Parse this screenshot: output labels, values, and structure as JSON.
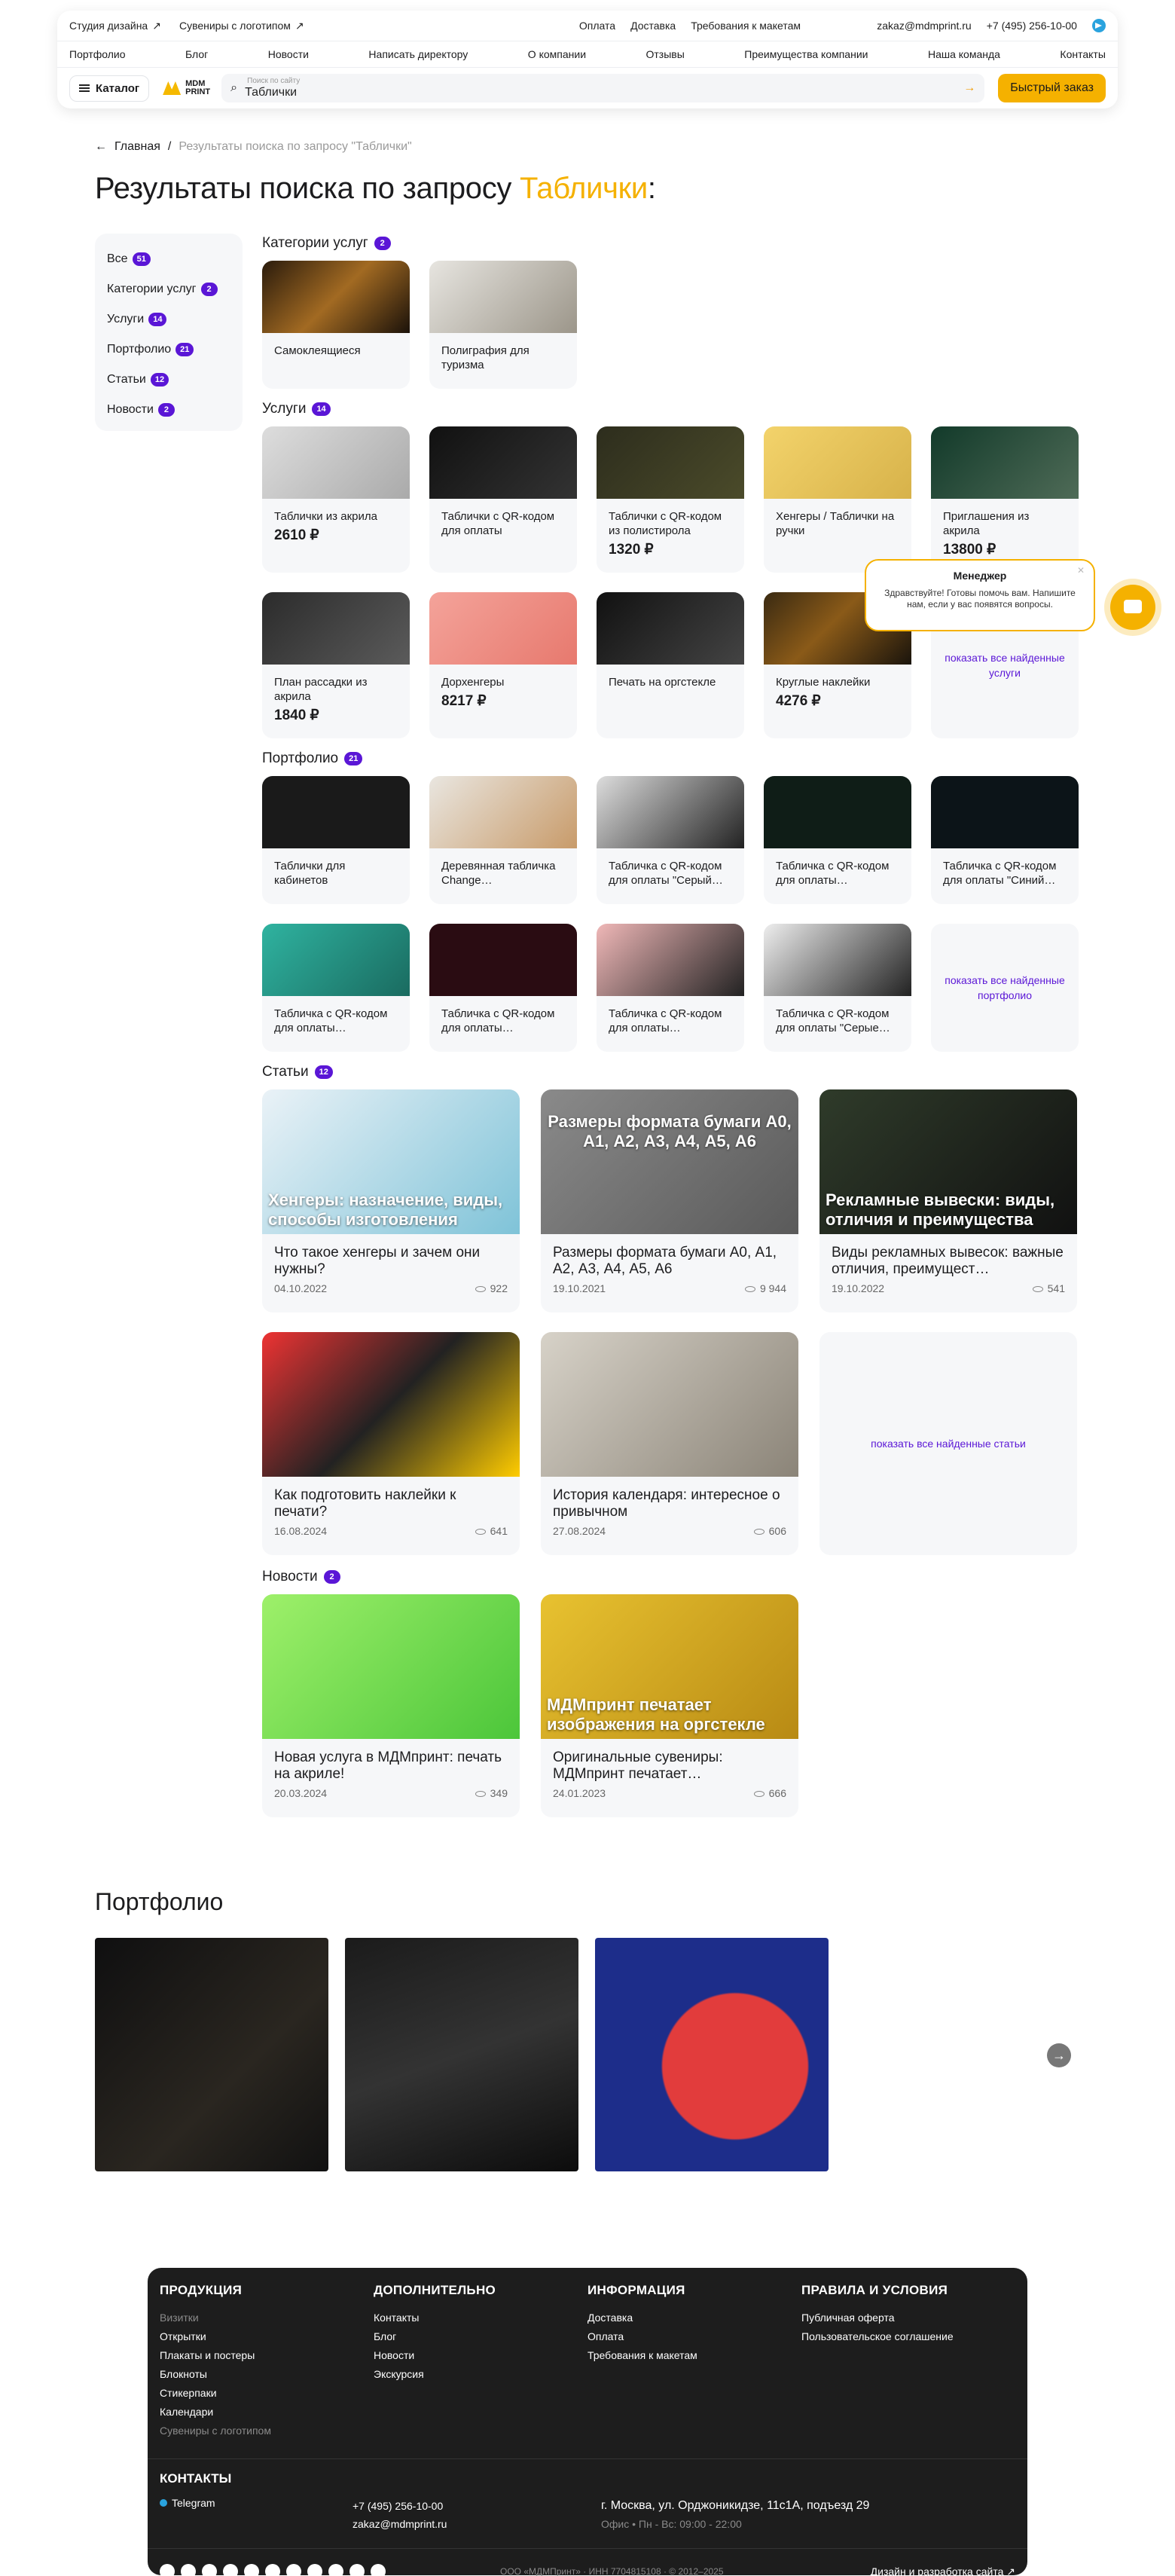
{
  "header": {
    "top_links": [
      "Студия дизайна",
      "Сувениры с логотипом"
    ],
    "top_mid": [
      "Оплата",
      "Доставка",
      "Требования к макетам"
    ],
    "email": "zakaz@mdmprint.ru",
    "phone": "+7 (495) 256-10-00",
    "nav": [
      "Портфолио",
      "Блог",
      "Новости",
      "Написать директору",
      "О компании",
      "Отзывы",
      "Преимущества компании",
      "Наша команда",
      "Контакты"
    ],
    "catalog_label": "Каталог",
    "logo_text": "MDM PRINT",
    "search_hint": "Поиск по сайту",
    "search_value": "Таблички",
    "quick_order": "Быстрый заказ"
  },
  "breadcrumb": {
    "home": "Главная",
    "current": "Результаты поиска по запросу \"Таблички\""
  },
  "page_title": {
    "prefix": "Результаты поиска по запросу",
    "query": "Таблички",
    "suffix": ":"
  },
  "sidebar": [
    {
      "label": "Все",
      "count": "51"
    },
    {
      "label": "Категории услуг",
      "count": "2"
    },
    {
      "label": "Услуги",
      "count": "14"
    },
    {
      "label": "Портфолио",
      "count": "21"
    },
    {
      "label": "Статьи",
      "count": "12"
    },
    {
      "label": "Новости",
      "count": "2"
    }
  ],
  "sections": {
    "categories": {
      "title": "Категории услуг",
      "count": "2",
      "items": [
        "Самоклеящиеся",
        "Полиграфия для туризма"
      ]
    },
    "services": {
      "title": "Услуги",
      "count": "14",
      "items": [
        {
          "t": "Таблички из акрила",
          "p": "2610 ₽"
        },
        {
          "t": "Таблички с QR-кодом для оплаты",
          "p": ""
        },
        {
          "t": "Таблички с QR-кодом из полистирола",
          "p": "1320 ₽"
        },
        {
          "t": "Хенгеры / Таблички на ручки",
          "p": ""
        },
        {
          "t": "Приглашения из акрила",
          "p": "13800 ₽"
        },
        {
          "t": "План рассадки из акрила",
          "p": "1840 ₽"
        },
        {
          "t": "Дорхенгеры",
          "p": "8217 ₽"
        },
        {
          "t": "Печать на оргстекле",
          "p": ""
        },
        {
          "t": "Круглые наклейки",
          "p": "4276 ₽"
        }
      ],
      "more": "показать все найденные услуги"
    },
    "portfolio": {
      "title": "Портфолио",
      "count": "21",
      "items": [
        "Таблички для кабинетов",
        "Деревянная табличка Change…",
        "Табличка с QR-кодом для оплаты \"Серый…",
        "Табличка с QR-кодом для оплаты…",
        "Табличка с QR-кодом для оплаты \"Синий…",
        "Табличка с QR-кодом для оплаты…",
        "Табличка с QR-кодом для оплаты…",
        "Табличка с QR-кодом для оплаты…",
        "Табличка с QR-кодом для оплаты \"Серые…"
      ],
      "more": "показать все найденные портфолио"
    },
    "articles": {
      "title": "Статьи",
      "count": "12",
      "items": [
        {
          "ov": "Хенгеры: назначение, виды, способы изготовления",
          "t": "Что такое хенгеры и зачем они нужны?",
          "d": "04.10.2022",
          "v": "922"
        },
        {
          "ov": "",
          "t": "Размеры формата бумаги А0, А1, А2, А3, А4, А5, А6",
          "d": "19.10.2021",
          "v": "9 944"
        },
        {
          "ov": "Рекламные вывески: виды, отличия и преимущества",
          "t": "Виды рекламных вывесок: важные отличия, преимущест…",
          "d": "19.10.2022",
          "v": "541"
        },
        {
          "ov": "",
          "t": "Как подготовить наклейки к печати?",
          "d": "16.08.2024",
          "v": "641"
        },
        {
          "ov": "",
          "t": "История календаря: интересное о привычном",
          "d": "27.08.2024",
          "v": "606"
        }
      ],
      "img2_text": "Размеры формата бумаги А0, А1, А2, А3, А4, А5, А6",
      "more": "показать все найденные статьи"
    },
    "news": {
      "title": "Новости",
      "count": "2",
      "items": [
        {
          "ov": "",
          "t": "Новая услуга в МДМпринт: печать на акриле!",
          "d": "20.03.2024",
          "v": "349"
        },
        {
          "ov": "МДМпринт печатает изображения на оргстекле",
          "t": "Оригинальные сувениры: МДМпринт печатает…",
          "d": "24.01.2023",
          "v": "666"
        }
      ]
    }
  },
  "portfolio_block": {
    "title": "Портфолио"
  },
  "chat": {
    "title": "Менеджер",
    "text": "Здравствуйте! Готовы помочь вам. Напишите нам, если у вас появятся вопросы."
  },
  "footer": {
    "products": {
      "title": "ПРОДУКЦИЯ",
      "items": [
        "Визитки",
        "Открытки",
        "Плакаты и постеры",
        "Блокноты",
        "Стикерпаки",
        "Календари",
        "Сувениры с логотипом"
      ]
    },
    "extra": {
      "title": "ДОПОЛНИТЕЛЬНО",
      "items": [
        "Контакты",
        "Блог",
        "Новости",
        "Экскурсия"
      ]
    },
    "info": {
      "title": "ИНФОРМАЦИЯ",
      "items": [
        "Доставка",
        "Оплата",
        "Требования к макетам"
      ]
    },
    "rules": {
      "title": "ПРАВИЛА И УСЛОВИЯ",
      "items": [
        "Публичная оферта",
        "Пользовательское соглашение"
      ]
    },
    "contacts_title": "КОНТАКТЫ",
    "telegram": "Telegram",
    "phone": "+7 (495) 256-10-00",
    "email": "zakaz@mdmprint.ru",
    "address": "г. Москва, ул. Орджоникидзе, 11с1А, подъезд 29",
    "schedule": "Офис • Пн - Вс: 09:00 - 22:00",
    "copyright": "ООО «МДМПринт»  ·  ИНН 7704815108  ·  © 2012–2025",
    "dev": "Дизайн и разработка сайта"
  }
}
